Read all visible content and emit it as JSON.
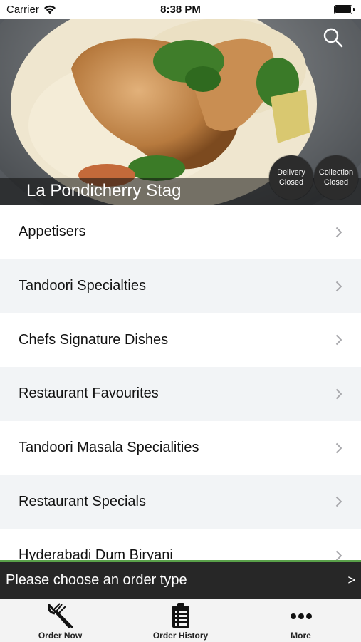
{
  "status_bar": {
    "carrier": "Carrier",
    "time": "8:38 PM"
  },
  "hero": {
    "restaurant_name": "La Pondicherry Stag",
    "delivery": {
      "line1": "Delivery",
      "line2": "Closed"
    },
    "collection": {
      "line1": "Collection",
      "line2": "Closed"
    }
  },
  "menu": {
    "categories": [
      "Appetisers",
      "Tandoori Specialties",
      "Chefs Signature Dishes",
      "Restaurant Favourites",
      "Tandoori Masala Specialities",
      "Restaurant Specials",
      "Hyderabadi Dum Biryani"
    ]
  },
  "order_bar": {
    "text": "Please choose an order type",
    "arrow": ">"
  },
  "tabs": [
    {
      "label": "Order Now",
      "icon": "fork-knife-icon"
    },
    {
      "label": "Order History",
      "icon": "clipboard-list-icon"
    },
    {
      "label": "More",
      "icon": "more-dots-icon"
    }
  ],
  "colors": {
    "accent_line": "#5aa14a",
    "order_bar": "#272727",
    "tab_bar": "#f3f3f3"
  }
}
